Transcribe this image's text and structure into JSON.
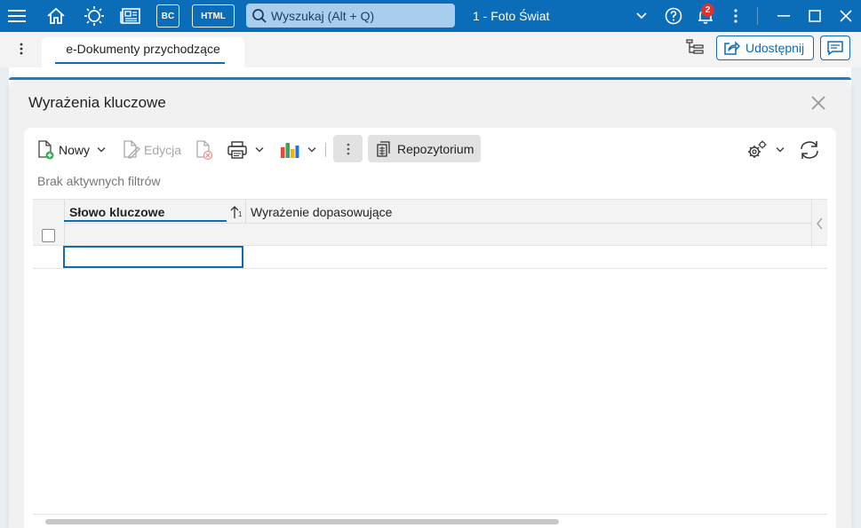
{
  "titlebar": {
    "search_placeholder": "Wyszukaj (Alt + Q)",
    "company": "1 - Foto Świat",
    "notifications_count": "2",
    "bc_label": "BC",
    "html_label": "HTML"
  },
  "tabs": {
    "active_label": "e-Dokumenty przychodzące",
    "share_label": "Udostępnij"
  },
  "dialog": {
    "title": "Wyrażenia kluczowe",
    "toolbar": {
      "new_label": "Nowy",
      "edit_label": "Edycja",
      "repo_label": "Repozytorium"
    },
    "filter_status": "Brak aktywnych filtrów",
    "grid": {
      "columns": [
        "Słowo kluczowe",
        "Wyrażenie dopasowujące"
      ],
      "sort_index": "1"
    }
  },
  "colors": {
    "accent": "#0b6cb8",
    "badge": "#e03131"
  }
}
